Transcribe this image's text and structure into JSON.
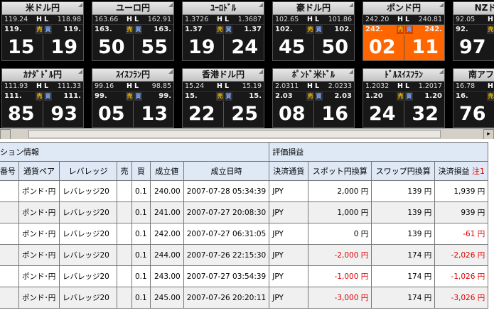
{
  "tiles_row1": [
    {
      "name": "米ドル円",
      "high": "119.24",
      "low": "118.98",
      "bid_prefix": "119.",
      "ask_prefix": "119.",
      "bid_big": "15",
      "ask_big": "19",
      "hot": false
    },
    {
      "name": "ユーロ円",
      "high": "163.66",
      "low": "162.91",
      "bid_prefix": "163.",
      "ask_prefix": "163.",
      "bid_big": "50",
      "ask_big": "55",
      "hot": false
    },
    {
      "name": "ﾕｰﾛﾄﾞﾙ",
      "high": "1.3726",
      "low": "1.3687",
      "bid_prefix": "1.37",
      "ask_prefix": "1.37",
      "bid_big": "19",
      "ask_big": "24",
      "hot": false
    },
    {
      "name": "豪ドル円",
      "high": "102.65",
      "low": "101.86",
      "bid_prefix": "102.",
      "ask_prefix": "102.",
      "bid_big": "45",
      "ask_big": "50",
      "hot": false
    },
    {
      "name": "ポンド円",
      "high": "242.20",
      "low": "240.81",
      "bid_prefix": "242.",
      "ask_prefix": "242.",
      "bid_big": "02",
      "ask_big": "11",
      "hot": true
    },
    {
      "name": "NZドル円",
      "high": "92.05",
      "low": "",
      "bid_prefix": "92.",
      "ask_prefix": "",
      "bid_big": "97",
      "ask_big": "",
      "hot": false
    }
  ],
  "tiles_row2": [
    {
      "name": "ｶﾅﾀﾞﾄﾞﾙ円",
      "high": "111.93",
      "low": "111.33",
      "bid_prefix": "111.",
      "ask_prefix": "111.",
      "bid_big": "85",
      "ask_big": "93",
      "hot": false
    },
    {
      "name": "ｽｲｽﾌﾗﾝ円",
      "high": "99.16",
      "low": "98.85",
      "bid_prefix": "99.",
      "ask_prefix": "99.",
      "bid_big": "05",
      "ask_big": "13",
      "hot": false
    },
    {
      "name": "香港ドル円",
      "high": "15.24",
      "low": "15.19",
      "bid_prefix": "15.",
      "ask_prefix": "15.",
      "bid_big": "22",
      "ask_big": "25",
      "hot": false
    },
    {
      "name": "ﾎﾟﾝﾄﾞ米ﾄﾞﾙ",
      "high": "2.0311",
      "low": "2.0233",
      "bid_prefix": "2.03",
      "ask_prefix": "2.03",
      "bid_big": "08",
      "ask_big": "16",
      "hot": false
    },
    {
      "name": "ﾄﾞﾙｽｲｽﾌﾗﾝ",
      "high": "1.2032",
      "low": "1.2017",
      "bid_prefix": "1.20",
      "ask_prefix": "1.20",
      "bid_big": "24",
      "ask_big": "32",
      "hot": false
    },
    {
      "name": "南アフリカ円",
      "high": "16.78",
      "low": "",
      "bid_prefix": "16.",
      "ask_prefix": "",
      "bid_big": "76",
      "ask_big": "",
      "hot": false
    }
  ],
  "tile_labels": {
    "h": "H",
    "l": "L",
    "sell": "売",
    "buy": "買"
  },
  "section": {
    "position_info": "ション情報",
    "pnl": "評価損益"
  },
  "columns": [
    "番号",
    "通貨ペア",
    "レバレッジ",
    "売",
    "買",
    "成立値",
    "成立日時",
    "決済通貨",
    "スポット円換算",
    "スワップ円換算",
    "決済損益"
  ],
  "note_label": "注1",
  "rows": [
    {
      "pair": "ポンド･円",
      "leverage": "レバレッジ20",
      "sell": "",
      "buy": "0.1",
      "price": "240.00",
      "datetime": "2007-07-28 05:34:39",
      "currency": "JPY",
      "spot": "2,000 円",
      "swap": "139 円",
      "pnl": "1,939 円",
      "spot_red": false,
      "pnl_red": false
    },
    {
      "pair": "ポンド･円",
      "leverage": "レバレッジ20",
      "sell": "",
      "buy": "0.1",
      "price": "241.00",
      "datetime": "2007-07-27 20:08:30",
      "currency": "JPY",
      "spot": "1,000 円",
      "swap": "139 円",
      "pnl": "939 円",
      "spot_red": false,
      "pnl_red": false
    },
    {
      "pair": "ポンド･円",
      "leverage": "レバレッジ20",
      "sell": "",
      "buy": "0.1",
      "price": "242.00",
      "datetime": "2007-07-27 06:31:05",
      "currency": "JPY",
      "spot": "0 円",
      "swap": "139 円",
      "pnl": "-61 円",
      "spot_red": false,
      "pnl_red": true
    },
    {
      "pair": "ポンド･円",
      "leverage": "レバレッジ20",
      "sell": "",
      "buy": "0.1",
      "price": "244.00",
      "datetime": "2007-07-26 22:15:30",
      "currency": "JPY",
      "spot": "-2,000 円",
      "swap": "174 円",
      "pnl": "-2,026 円",
      "spot_red": true,
      "pnl_red": true
    },
    {
      "pair": "ポンド･円",
      "leverage": "レバレッジ20",
      "sell": "",
      "buy": "0.1",
      "price": "243.00",
      "datetime": "2007-07-27 03:54:39",
      "currency": "JPY",
      "spot": "-1,000 円",
      "swap": "174 円",
      "pnl": "-1,026 円",
      "spot_red": true,
      "pnl_red": true
    },
    {
      "pair": "ポンド･円",
      "leverage": "レバレッジ20",
      "sell": "",
      "buy": "0.1",
      "price": "245.00",
      "datetime": "2007-07-26 20:20:11",
      "currency": "JPY",
      "spot": "-3,000 円",
      "swap": "174 円",
      "pnl": "-3,026 円",
      "spot_red": true,
      "pnl_red": true
    }
  ],
  "colors": {
    "hot_tile": "#ff6600",
    "header_bg": "#dfe9f6",
    "negative": "#e00000"
  }
}
